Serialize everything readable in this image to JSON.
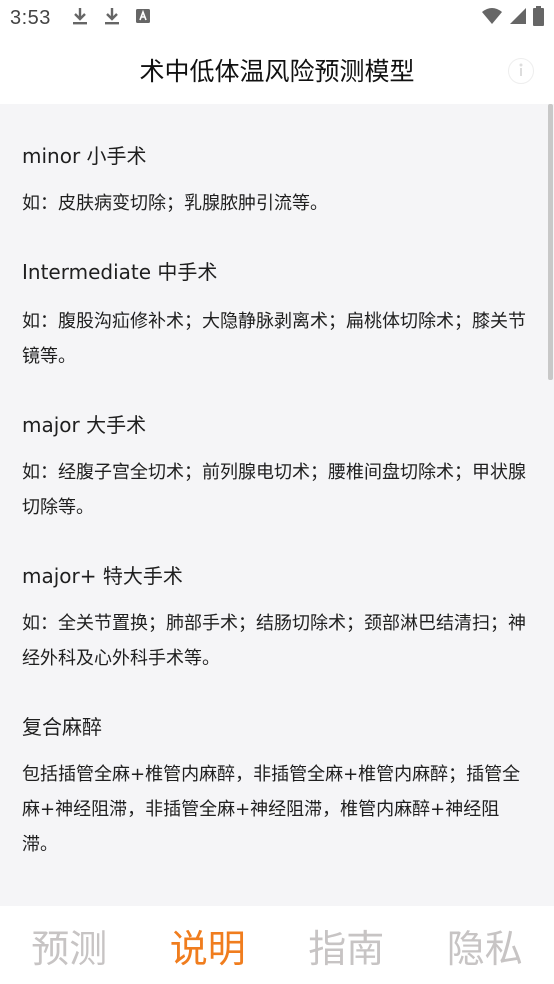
{
  "status_bar": {
    "time": "3:53",
    "left_icons": [
      "download-icon",
      "download-icon",
      "app-notification-icon"
    ],
    "right_icons": [
      "wifi-icon",
      "signal-icon",
      "battery-icon"
    ]
  },
  "header": {
    "title": "术中低体温风险预测模型",
    "info_icon": "info-icon"
  },
  "sections": [
    {
      "title": "minor 小手术",
      "desc": "如：皮肤病变切除；乳腺脓肿引流等。"
    },
    {
      "title": "Intermediate 中手术",
      "desc": "如：腹股沟疝修补术；大隐静脉剥离术；扁桃体切除术；膝关节镜等。"
    },
    {
      "title": "major 大手术",
      "desc": "如：经腹子宫全切术；前列腺电切术；腰椎间盘切除术；甲状腺切除等。"
    },
    {
      "title": "major+ 特大手术",
      "desc": "如：全关节置换；肺部手术；结肠切除术；颈部淋巴结清扫；神经外科及心外科手术等。"
    },
    {
      "title": "复合麻醉",
      "desc": "包括插管全麻+椎管内麻醉，非插管全麻+椎管内麻醉；插管全麻+神经阻滞，非插管全麻+神经阻滞，椎管内麻醉+神经阻滞。"
    }
  ],
  "tabs": [
    {
      "label": "预测",
      "active": false
    },
    {
      "label": "说明",
      "active": true
    },
    {
      "label": "指南",
      "active": false
    },
    {
      "label": "隐私",
      "active": false
    }
  ],
  "colors": {
    "accent": "#f07d1e",
    "tab_inactive": "#c7c4c4",
    "background": "#f5f5f7"
  }
}
